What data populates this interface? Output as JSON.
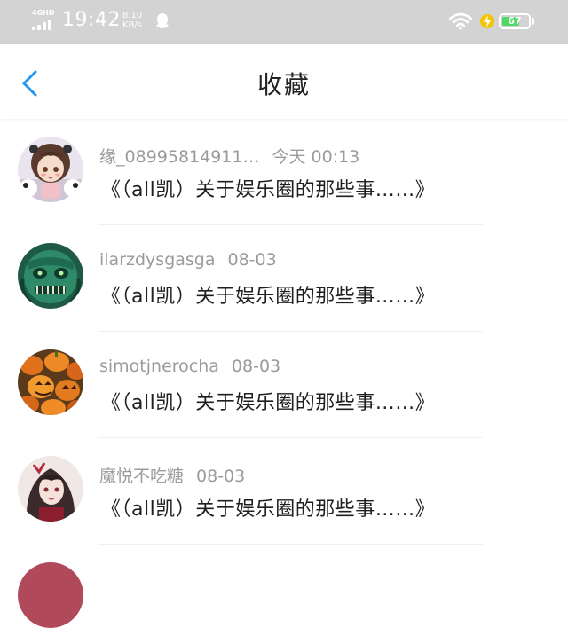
{
  "status_bar": {
    "network_type": "4GHD",
    "time": "19:42",
    "speed_value": "8.10",
    "speed_unit": "KB/s",
    "battery_level": "67",
    "battery_fraction": 0.67,
    "colors": {
      "bar_bg": "#d3d3d3",
      "battery_fill": "#4cd964",
      "charge_icon": "#f5c400"
    },
    "icons": [
      "signal-icon",
      "qq-icon",
      "wifi-icon",
      "charging-icon",
      "battery-icon"
    ]
  },
  "nav": {
    "title": "收藏",
    "back_icon": "chevron-left-icon",
    "accent_color": "#2196f3"
  },
  "favorites": [
    {
      "user": "缘_08995814911…",
      "time": "今天 00:13",
      "title": "《（all凯）关于娱乐圈的那些事……》",
      "avatar": "anime-girl-avatar"
    },
    {
      "user": "ilarzdysgasga",
      "time": "08-03",
      "title": "《（all凯）关于娱乐圈的那些事……》",
      "avatar": "green-mask-avatar"
    },
    {
      "user": "simotjnerocha",
      "time": "08-03",
      "title": "《（all凯）关于娱乐圈的那些事……》",
      "avatar": "pumpkins-avatar"
    },
    {
      "user": "魔悦不吃糖",
      "time": "08-03",
      "title": "《（all凯）关于娱乐圈的那些事……》",
      "avatar": "dark-hair-girl-avatar"
    }
  ]
}
